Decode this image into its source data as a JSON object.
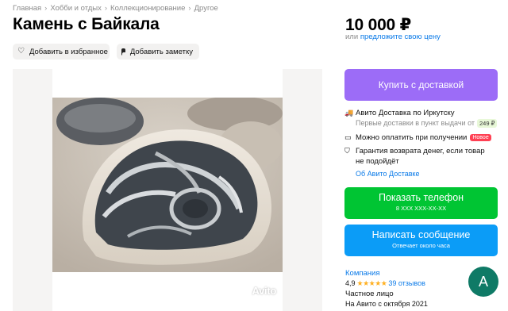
{
  "breadcrumb": [
    "Главная",
    "Хобби и отдых",
    "Коллекционирование",
    "Другое"
  ],
  "breadcrumb_separator": "›",
  "title": "Камень с Байкала",
  "actions": {
    "favorite_label": "Добавить в избранное",
    "note_label": "Добавить заметку"
  },
  "price": {
    "value": "10 000 ₽",
    "or_text": "или",
    "offer_link": "предложите свою цену"
  },
  "buttons": {
    "buy_label": "Купить с доставкой",
    "phone_label": "Показать телефон",
    "phone_number": "8 XXX XXX-XX-XX",
    "message_label": "Написать сообщение",
    "message_sub": "Отвечает около часа"
  },
  "delivery": {
    "title": "Авито Доставка по Иркутску",
    "first_delivery": "Первые доставки в пункт выдачи от",
    "first_price": "249 ₽",
    "pay_on_receive": "Можно оплатить при получении",
    "new_badge": "Новое",
    "guarantee_line1": "Гарантия возврата денег, если товар",
    "guarantee_line2": "не подойдёт",
    "about_link": "Об Авито Доставке"
  },
  "seller": {
    "type": "Компания",
    "rating": "4,9",
    "stars": "★★★★★",
    "reviews": "39 отзывов",
    "name": "Частное лицо",
    "since": "На Авито с октября 2021",
    "avatar_letter": "A",
    "avatar_color": "#0f7a66"
  },
  "gallery": {
    "watermark": "Avito"
  },
  "colors": {
    "buy": "#9c6cf7",
    "phone": "#00c533",
    "message": "#0b9cf7",
    "link": "#0a7ae8"
  },
  "icons": {
    "favorite": "heart-icon",
    "note": "note-icon",
    "delivery": "truck-icon",
    "payment": "wallet-icon",
    "guarantee": "shield-icon"
  }
}
